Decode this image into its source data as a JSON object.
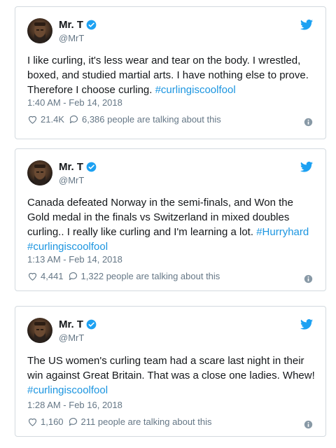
{
  "tweets": [
    {
      "name": "Mr. T",
      "handle": "@MrT",
      "text": "I like curling, it's less wear and tear on the body. I wrestled, boxed, and studied martial arts. I have nothing else to prove. Therefore I choose curling. ",
      "hashtags": "#curlingiscoolfool",
      "time": "1:40 AM - Feb 14, 2018",
      "likes": "21.4K",
      "talking": "6,386 people are talking about this"
    },
    {
      "name": "Mr. T",
      "handle": "@MrT",
      "text": "Canada defeated Norway in the semi-finals, and Won the Gold medal in the finals vs Switzerland in mixed doubles curling.. I really like curling and I'm learning a lot. ",
      "hashtag1": "#Hurryhard",
      "hashtags": "#curlingiscoolfool",
      "time": "1:13 AM - Feb 14, 2018",
      "likes": "4,441",
      "talking": "1,322 people are talking about this"
    },
    {
      "name": "Mr. T",
      "handle": "@MrT",
      "text": "The US women's curling team had a scare last night in their win against Great Britain. That was a close one ladies. Whew! ",
      "hashtags": "#curlingiscoolfool",
      "time": "1:28 AM - Feb 16, 2018",
      "likes": "1,160",
      "talking": "211 people are talking about this"
    }
  ],
  "icons": {
    "verified": "verified-badge-icon",
    "bird": "twitter-bird-icon",
    "like": "heart-icon",
    "reply": "speech-bubble-icon",
    "info": "info-icon"
  },
  "colors": {
    "accent": "#1da1f2",
    "hashtag": "#1b95e0",
    "muted": "#657786"
  }
}
